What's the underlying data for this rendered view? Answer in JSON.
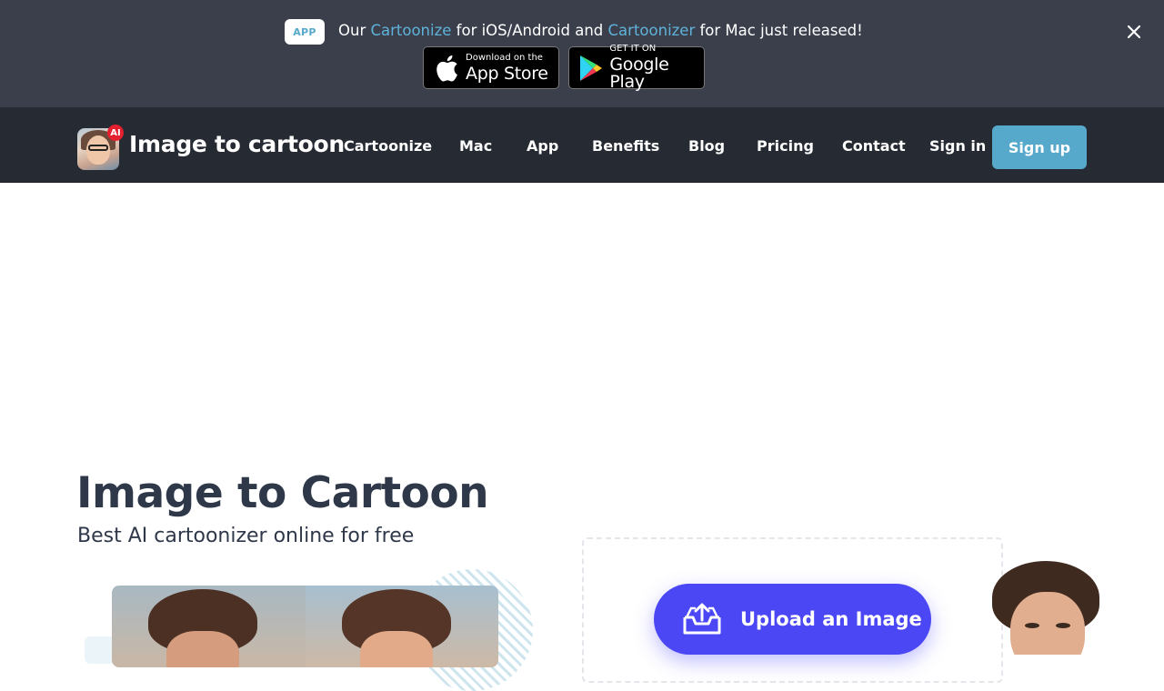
{
  "announcement": {
    "badge": "APP",
    "text_before": "Our ",
    "link1": "Cartoonize",
    "text_middle": " for iOS/Android and ",
    "link2": "Cartoonizer",
    "text_after": " for Mac just released!",
    "close_icon": "close-icon",
    "app_store": {
      "small": "Download on the",
      "big": "App Store"
    },
    "google_play": {
      "small": "GET IT ON",
      "big": "Google Play"
    }
  },
  "nav": {
    "brand": "Image to cartoon",
    "ai_badge": "AI",
    "links": [
      "Cartoonize",
      "Mac",
      "App",
      "Benefits",
      "Blog",
      "Pricing",
      "Contact"
    ],
    "sign_in": "Sign in",
    "sign_up": "Sign up"
  },
  "hero": {
    "title": "Image to Cartoon",
    "subtitle": "Best AI cartoonizer online for free",
    "upload_label": "Upload an Image"
  },
  "colors": {
    "announce_bg": "#3a3f4b",
    "nav_bg": "#262a33",
    "accent": "#56a9cb",
    "upload_button": "#4c47f5",
    "heading": "#2f3849"
  }
}
